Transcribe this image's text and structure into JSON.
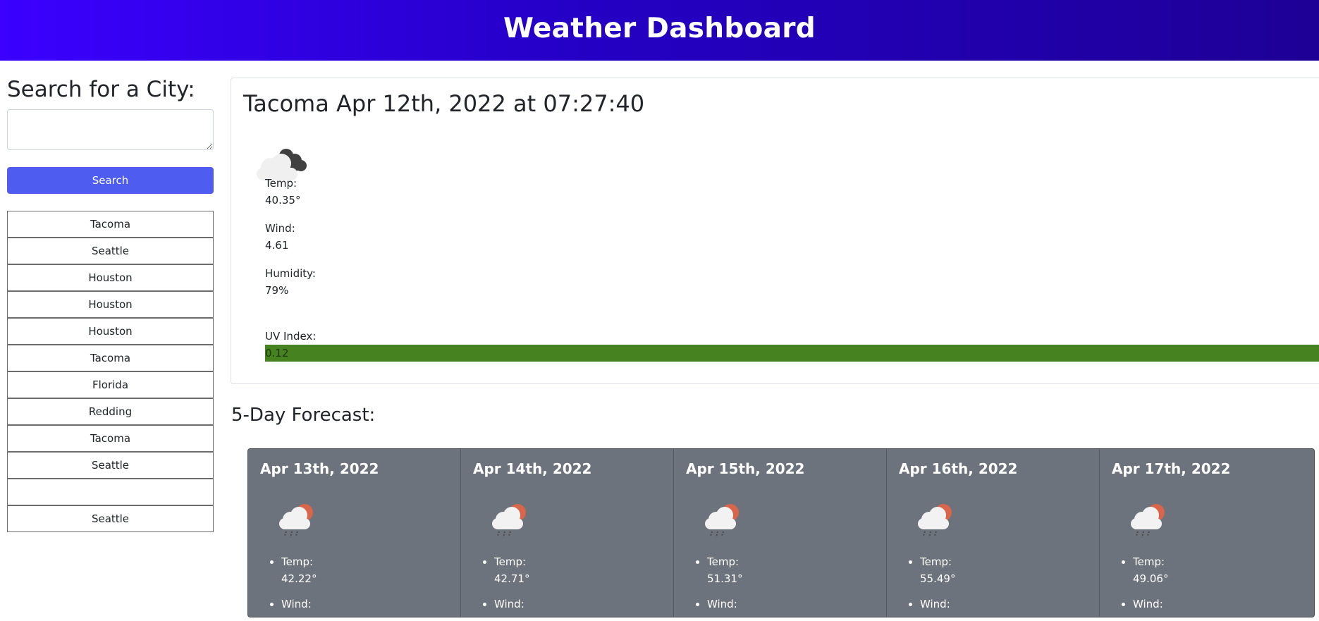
{
  "header": {
    "title": "Weather Dashboard",
    "bg_start": "#3b00ff",
    "bg_end": "#1e0096"
  },
  "sidebar": {
    "heading": "Search for a City:",
    "search_value": "",
    "search_button": "Search",
    "history": [
      "Tacoma",
      "Seattle",
      "Houston",
      "Houston",
      "Houston",
      "Tacoma",
      "Florida",
      "Redding",
      "Tacoma",
      "Seattle",
      "",
      "Seattle"
    ]
  },
  "current": {
    "title": "Tacoma Apr 12th, 2022 at 07:27:40",
    "icon": "cloudy-icon",
    "temp_label": "Temp:",
    "temp": "40.35°",
    "wind_label": "Wind:",
    "wind": "4.61",
    "humidity_label": "Humidity:",
    "humidity": "79%",
    "uv_label": "UV Index:",
    "uv": "0.12",
    "uv_color": "#46821f"
  },
  "forecast": {
    "title": "5-Day Forecast:",
    "days": [
      {
        "date": "Apr 13th, 2022",
        "icon": "rain-sun-icon",
        "temp_label": "Temp:",
        "temp": "42.22°",
        "wind_label": "Wind:"
      },
      {
        "date": "Apr 14th, 2022",
        "icon": "rain-sun-icon",
        "temp_label": "Temp:",
        "temp": "42.71°",
        "wind_label": "Wind:"
      },
      {
        "date": "Apr 15th, 2022",
        "icon": "rain-sun-icon",
        "temp_label": "Temp:",
        "temp": "51.31°",
        "wind_label": "Wind:"
      },
      {
        "date": "Apr 16th, 2022",
        "icon": "rain-sun-icon",
        "temp_label": "Temp:",
        "temp": "55.49°",
        "wind_label": "Wind:"
      },
      {
        "date": "Apr 17th, 2022",
        "icon": "rain-sun-icon",
        "temp_label": "Temp:",
        "temp": "49.06°",
        "wind_label": "Wind:"
      }
    ]
  }
}
